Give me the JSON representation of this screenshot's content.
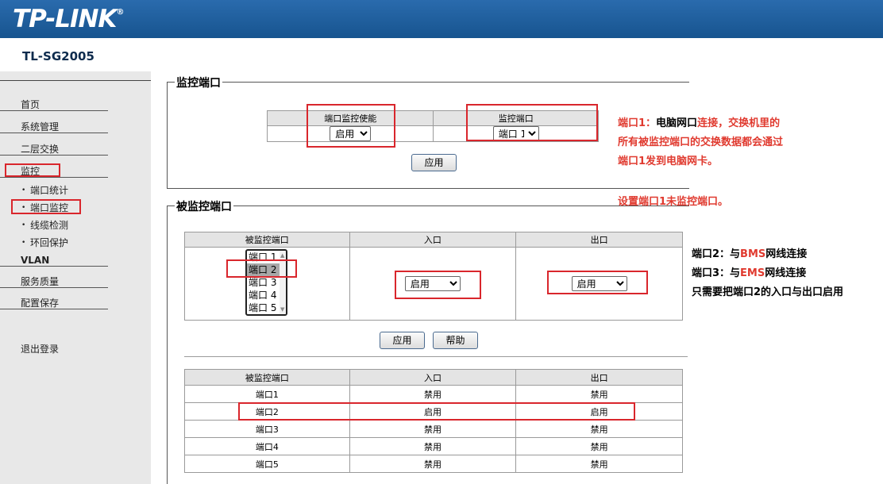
{
  "header": {
    "brand": "TP-LINK",
    "brand_mark": "®",
    "model": "TL-SG2005"
  },
  "sidebar": {
    "items": [
      {
        "label": "首页"
      },
      {
        "label": "系统管理"
      },
      {
        "label": "二层交换"
      },
      {
        "label": "监控"
      },
      {
        "label": "端口统计"
      },
      {
        "label": "端口监控"
      },
      {
        "label": "线缆检测"
      },
      {
        "label": "环回保护"
      },
      {
        "label": "VLAN"
      },
      {
        "label": "服务质量"
      },
      {
        "label": "配置保存"
      },
      {
        "label": "退出登录"
      }
    ]
  },
  "monitor_port": {
    "title": "监控端口",
    "col_enable": "端口监控使能",
    "col_port": "监控端口",
    "enable_value": "启用",
    "port_value": "端口 1",
    "apply": "应用"
  },
  "monitored_port": {
    "title": "被监控端口",
    "col_port": "被监控端口",
    "col_in": "入口",
    "col_out": "出口",
    "ports": [
      "端口 1",
      "端口 2",
      "端口 3",
      "端口 4",
      "端口 5"
    ],
    "selected_port": "端口 2",
    "in_value": "启用",
    "out_value": "启用",
    "apply": "应用",
    "help": "帮助"
  },
  "summary": {
    "headers": [
      "被监控端口",
      "入口",
      "出口"
    ],
    "rows": [
      [
        "端口1",
        "禁用",
        "禁用"
      ],
      [
        "端口2",
        "启用",
        "启用"
      ],
      [
        "端口3",
        "禁用",
        "禁用"
      ],
      [
        "端口4",
        "禁用",
        "禁用"
      ],
      [
        "端口5",
        "禁用",
        "禁用"
      ]
    ]
  },
  "notes": {
    "n1_prefix": "端口1：",
    "n1_bold": "电脑网口",
    "n1_rest": "连接，交换机里的",
    "n2": "所有被监控端口的交换数据都会通过",
    "n3": "端口1发到电脑网卡。",
    "n4": "设置端口1未监控端口。",
    "n5_a": "端口2：与",
    "n5_b": "BMS",
    "n5_c": "网线连接",
    "n6_a": "端口3：与",
    "n6_b": "EMS",
    "n6_c": "网线连接",
    "n7": "只需要把端口2的入口与出口启用"
  }
}
